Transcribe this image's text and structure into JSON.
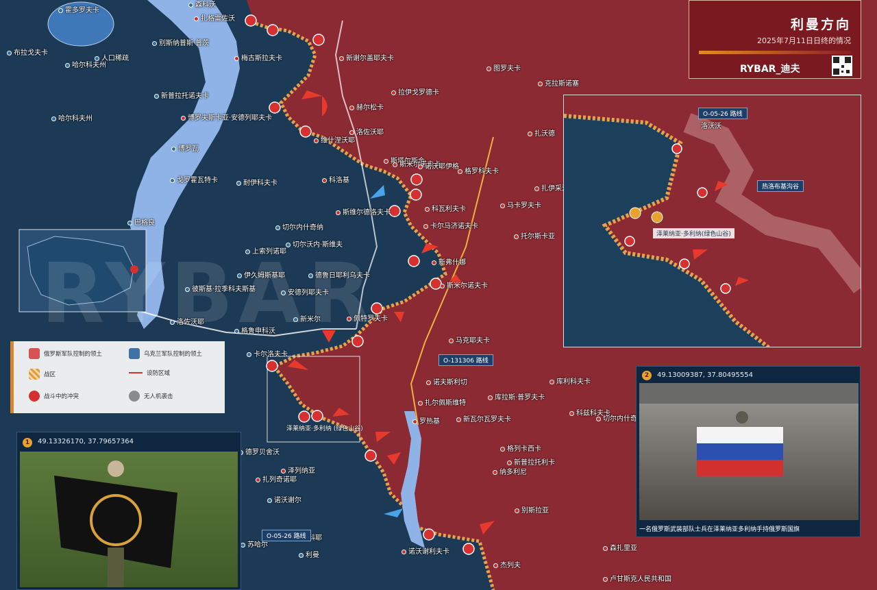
{
  "header": {
    "title": "利曼方向",
    "subtitle": "2025年7月11日日终的情况",
    "brand": "RYBAR_迪夫",
    "colors": {
      "header_bg": "#7a1a20",
      "ru_territory": "#8c2a33",
      "ua_territory": "#1f4a6e",
      "river": "#8fb3e6",
      "frontline": "#e8a24a"
    }
  },
  "towns": [
    {
      "name": "霍多罗夫卡",
      "side": "ua"
    },
    {
      "name": "人口稀疏",
      "side": "ua"
    },
    {
      "name": "森科沃",
      "side": "ua"
    },
    {
      "name": "扎格雷佐沃",
      "side": "ru"
    },
    {
      "name": "布拉戈夫卡",
      "side": "ua"
    },
    {
      "name": "别斯纳普斯·普茨",
      "side": "ua"
    },
    {
      "name": "梅古斯拉夫卡",
      "side": "ru"
    },
    {
      "name": "哈尔科夫州",
      "side": "ua"
    },
    {
      "name": "新普拉托诺夫卡",
      "side": "ua"
    },
    {
      "name": "博罗夫斯卡亚·安德列耶夫卡",
      "side": "ru"
    },
    {
      "name": "博罗瓦",
      "side": "ua"
    },
    {
      "name": "维什涅沃耶",
      "side": "ru"
    },
    {
      "name": "耐伊科夫卡",
      "side": "ua"
    },
    {
      "name": "科洛基",
      "side": "ru"
    },
    {
      "name": "戈罗霍瓦特卡",
      "side": "ua"
    },
    {
      "name": "巴格良",
      "side": "ua"
    },
    {
      "name": "斯维尔德洛夫卡",
      "side": "ru"
    },
    {
      "name": "切尔内什奇纳",
      "side": "ua"
    },
    {
      "name": "切尔沃内·斯维夫",
      "side": "ua"
    },
    {
      "name": "上索列诺耶",
      "side": "ua"
    },
    {
      "name": "伊久姆斯基耶",
      "side": "ua"
    },
    {
      "name": "德鲁日耶利乌夫卡",
      "side": "ua"
    },
    {
      "name": "安德列耶夫卡",
      "side": "ua"
    },
    {
      "name": "彼斯基·拉季科夫斯基",
      "side": "ua"
    },
    {
      "name": "洛佐沃耶",
      "side": "ua"
    },
    {
      "name": "格鲁申科沃",
      "side": "ua"
    },
    {
      "name": "新米尔",
      "side": "ua"
    },
    {
      "name": "卡尔洛夫卡",
      "side": "ua"
    },
    {
      "name": "佩特罗夫卡",
      "side": "ru"
    },
    {
      "name": "斯塔尔斯金",
      "side": "ru"
    },
    {
      "name": "斯米尔诺夫卡",
      "side": "ru"
    },
    {
      "name": "诺沃耶伊格",
      "side": "ru"
    },
    {
      "name": "洛佐沃耶",
      "side": "ru"
    },
    {
      "name": "新谢尔盖耶夫卡",
      "side": "ru"
    },
    {
      "name": "拉伊戈罗德卡",
      "side": "ru"
    },
    {
      "name": "赫尔松卡",
      "side": "ru"
    },
    {
      "name": "科瓦利夫卡",
      "side": "ru"
    },
    {
      "name": "卡尔马济诺夫卡",
      "side": "ru"
    },
    {
      "name": "新弗什娜",
      "side": "ru"
    },
    {
      "name": "格罗科夫卡",
      "side": "ru"
    },
    {
      "name": "斯米尔诺夫卡",
      "side": "ru"
    },
    {
      "name": "马克耶夫卡",
      "side": "ru"
    },
    {
      "name": "诺夫斯利切",
      "side": "ru"
    },
    {
      "name": "扎尔佩斯维特",
      "side": "ru"
    },
    {
      "name": "罗热基",
      "side": "ru"
    },
    {
      "name": "新瓦尔瓦罗夫卡",
      "side": "ru"
    },
    {
      "name": "库拉斯·普罗夫卡",
      "side": "ru"
    },
    {
      "name": "格列卡西卡",
      "side": "ru"
    },
    {
      "name": "纳多利尼",
      "side": "ru"
    },
    {
      "name": "别斯拉亚",
      "side": "ru"
    },
    {
      "name": "新普拉托利卡",
      "side": "ru"
    },
    {
      "name": "科兹科夫卡",
      "side": "ru"
    },
    {
      "name": "库利科夫卡",
      "side": "ru"
    },
    {
      "name": "切尔内什奇纳",
      "side": "ru"
    },
    {
      "name": "扎沃德",
      "side": "ru"
    },
    {
      "name": "马卡罗夫卡",
      "side": "ru"
    },
    {
      "name": "托尔斯卡亚",
      "side": "ru"
    },
    {
      "name": "图罗夫卡",
      "side": "ru"
    },
    {
      "name": "克拉斯诺塞",
      "side": "ru"
    },
    {
      "name": "扎伊采沃",
      "side": "ru"
    },
    {
      "name": "诺沃谢尔",
      "side": "ua"
    },
    {
      "name": "德罗贝舍沃",
      "side": "ua"
    },
    {
      "name": "扎列奇诺耶",
      "side": "ru"
    },
    {
      "name": "托尔斯科耶",
      "side": "ru"
    },
    {
      "name": "利曼",
      "side": "ua"
    },
    {
      "name": "苏哈尔",
      "side": "ua"
    },
    {
      "name": "诺沃谢利夫卡",
      "side": "ru"
    },
    {
      "name": "杰列夫",
      "side": "ru"
    },
    {
      "name": "森扎里亚",
      "side": "ru"
    },
    {
      "name": "卢甘斯克人民共和国",
      "side": "ru"
    },
    {
      "name": "泽列纳亚",
      "side": "ru"
    },
    {
      "name": "哈尔科夫州",
      "side": "ua"
    }
  ],
  "legend": {
    "items": [
      {
        "label": "俄罗斯军队控制的领土",
        "swatch": "#d65353"
      },
      {
        "label": "乌克兰军队控制的领土",
        "swatch": "#3f73a8"
      },
      {
        "label": "战区",
        "swatch": "#e69b3a"
      },
      {
        "label": "设防区域",
        "swatch": "#d63030"
      },
      {
        "label": "战斗中的冲突",
        "swatch": "#d63030"
      },
      {
        "label": "无人机袭击",
        "swatch": "#8a8a8a"
      }
    ]
  },
  "inset": {
    "road_label": "O-05-26 路线",
    "area_label": "热洛布基沟谷",
    "ravine_label": "泽莱纳亚·多利纳(绿色山谷)",
    "towns": [
      {
        "name": "洛沃沃",
        "side": "ru"
      }
    ]
  },
  "roads": [
    {
      "label": "O-131306 路线"
    },
    {
      "label": "O-05-26 路线"
    }
  ],
  "callouts": [
    {
      "label": "泽莱纳亚·多利纳 (绿色山谷)"
    }
  ],
  "photo1": {
    "number": "1",
    "coords": "49.13326170, 37.79657364"
  },
  "photo2": {
    "number": "2",
    "coords": "49.13009387, 37.80495554",
    "caption": "一名俄罗斯武装部队士兵在泽莱纳亚多利纳手持俄罗斯国旗"
  },
  "watermark": "RYBAR"
}
